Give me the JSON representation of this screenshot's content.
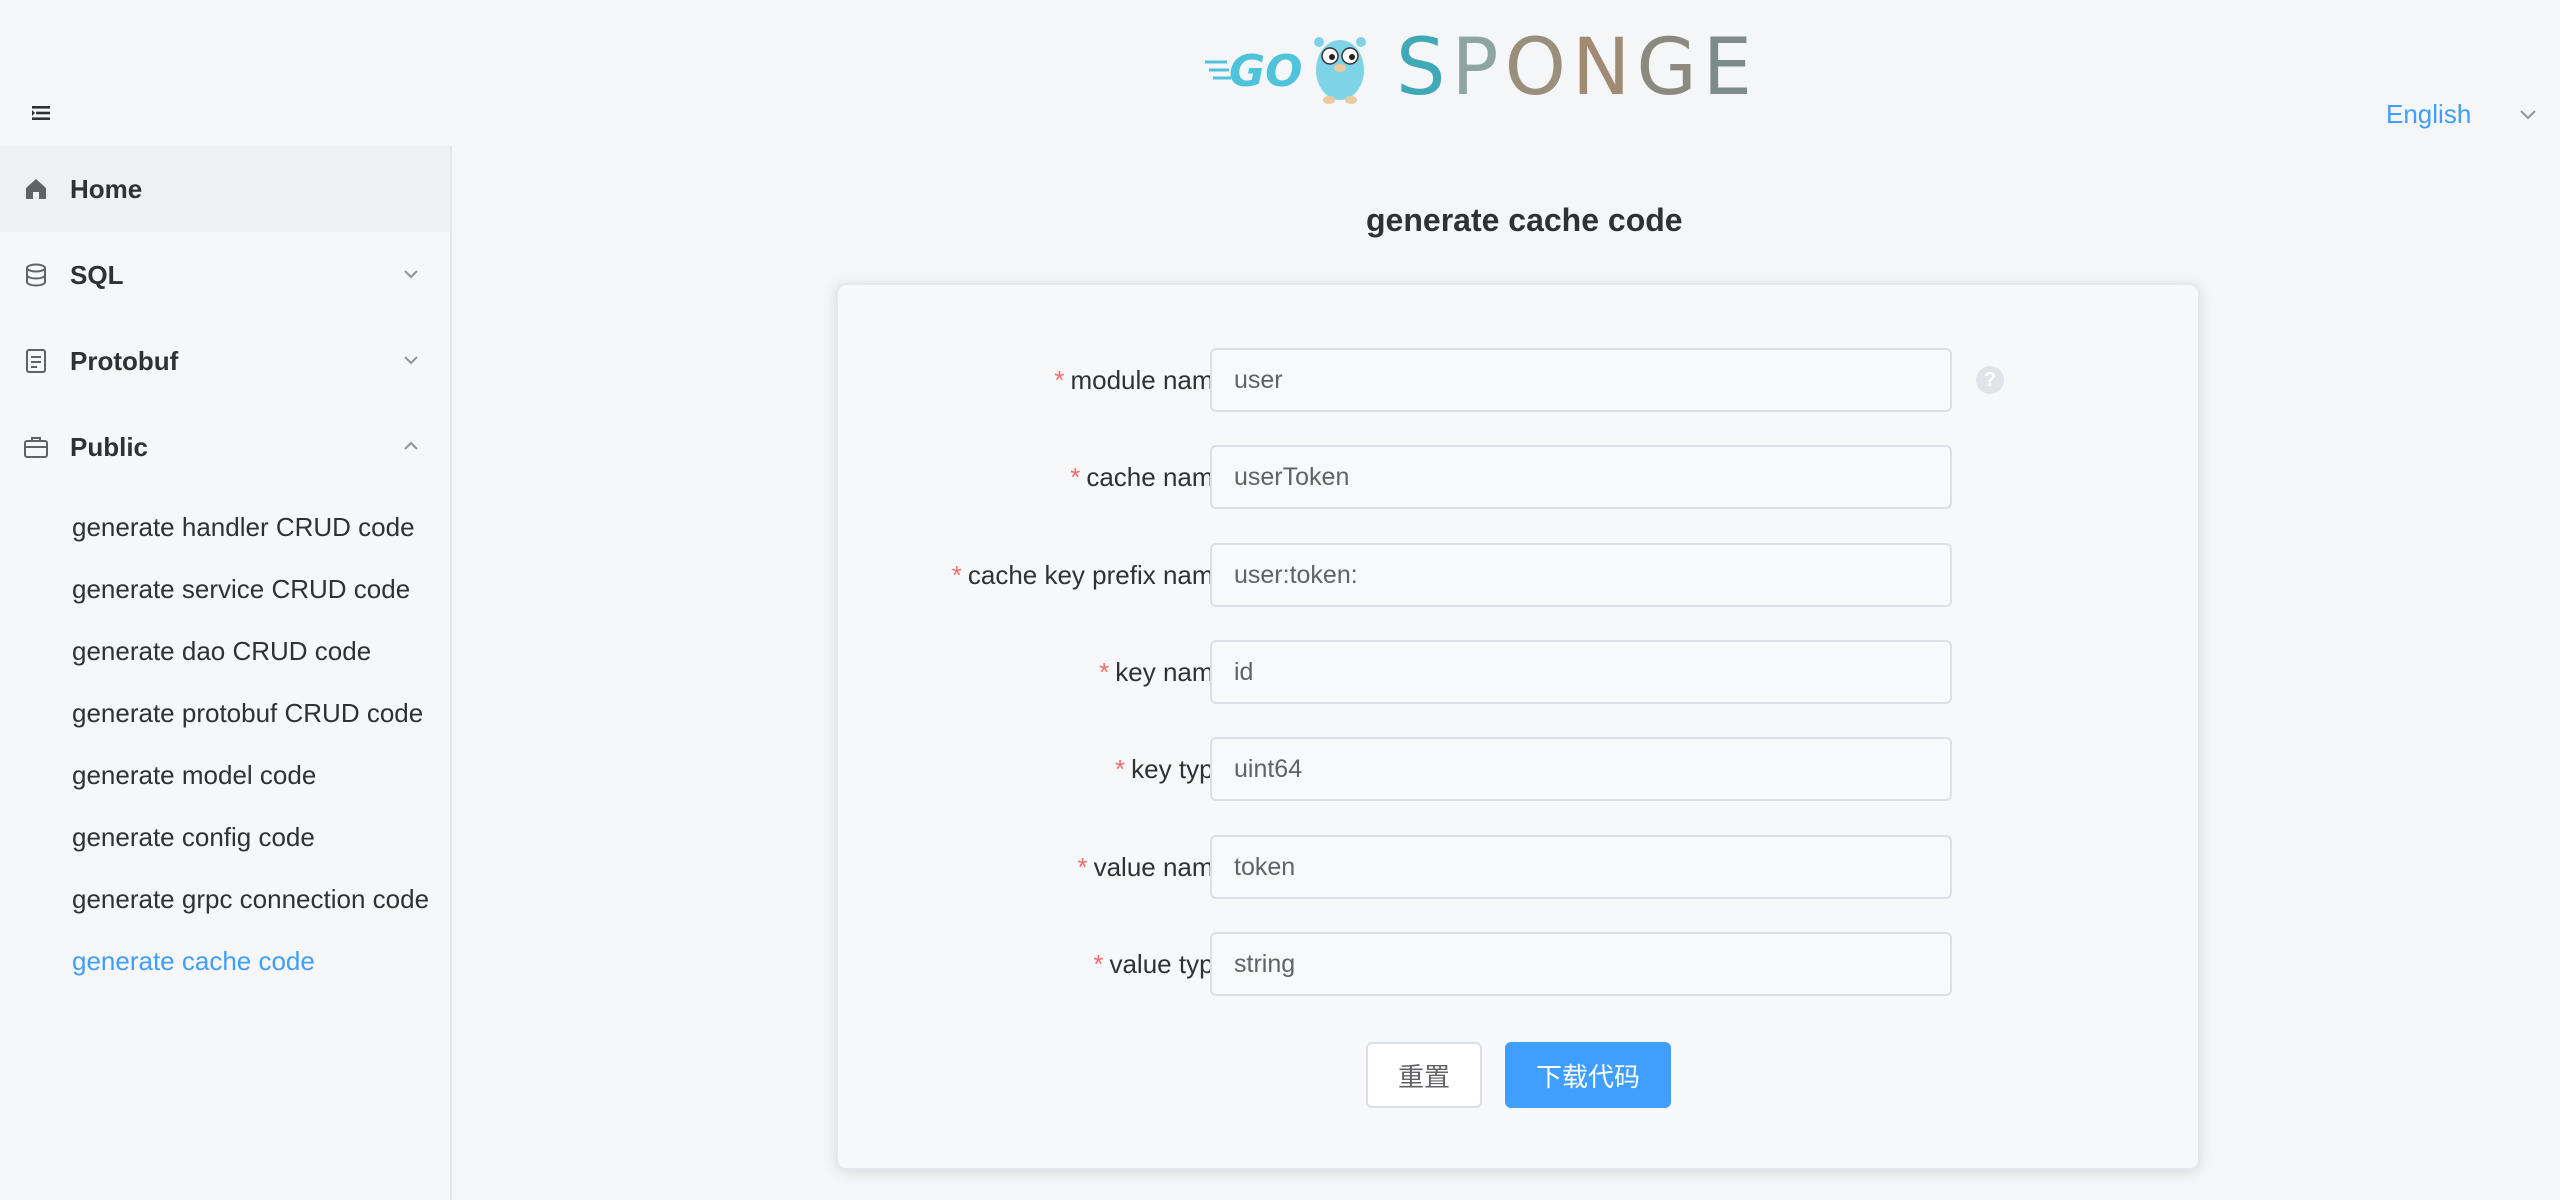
{
  "header": {
    "logo_text": "SPONGE",
    "logo_badge": "GO",
    "language": "English"
  },
  "sidebar": {
    "items": [
      {
        "label": "Home",
        "icon": "home-icon"
      },
      {
        "label": "SQL",
        "icon": "database-icon"
      },
      {
        "label": "Protobuf",
        "icon": "document-icon"
      },
      {
        "label": "Public",
        "icon": "briefcase-icon"
      }
    ],
    "public_sub_items": [
      "generate handler CRUD code",
      "generate service CRUD code",
      "generate dao CRUD code",
      "generate protobuf CRUD code",
      "generate model code",
      "generate config code",
      "generate grpc connection code",
      "generate cache code"
    ],
    "active_sub_item": "generate cache code"
  },
  "main": {
    "title": "generate cache code",
    "required_mark": "*",
    "fields": [
      {
        "label": "module name",
        "value": "user"
      },
      {
        "label": "cache name",
        "value": "userToken"
      },
      {
        "label": "cache key prefix name",
        "value": "user:token:"
      },
      {
        "label": "key name",
        "value": "id"
      },
      {
        "label": "key type",
        "value": "uint64"
      },
      {
        "label": "value name",
        "value": "token"
      },
      {
        "label": "value type",
        "value": "string"
      }
    ],
    "help_glyph": "?",
    "reset_label": "重置",
    "download_label": "下载代码"
  },
  "colors": {
    "accent": "#409eff",
    "required": "#f56c6c",
    "text": "#303133"
  }
}
